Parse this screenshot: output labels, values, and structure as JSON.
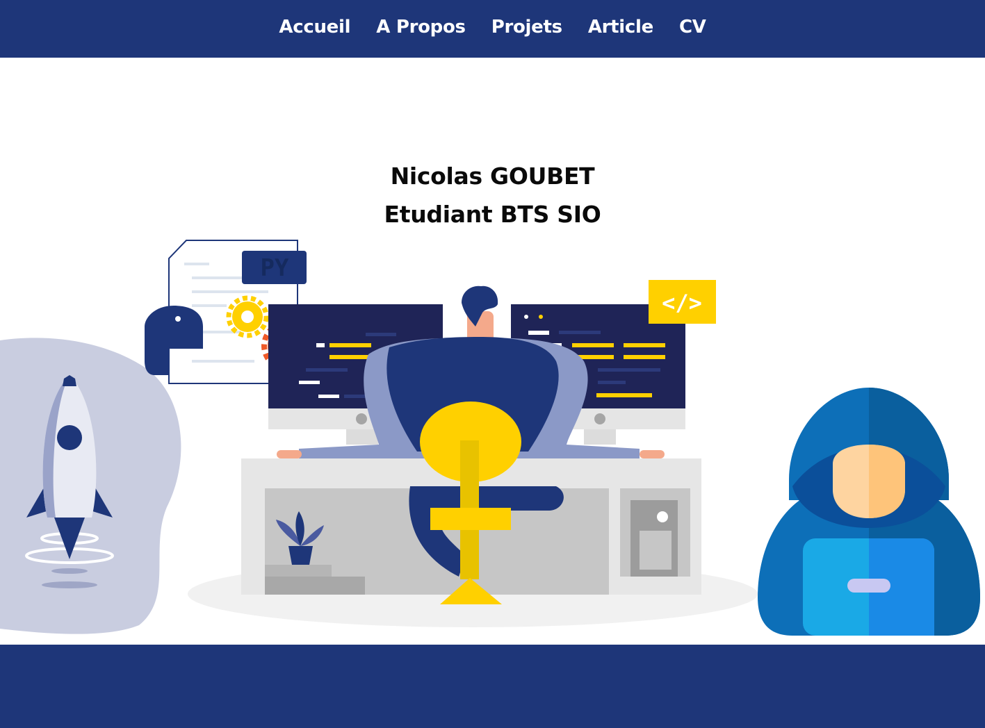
{
  "nav": {
    "items": [
      {
        "label": "Accueil"
      },
      {
        "label": "A Propos"
      },
      {
        "label": "Projets"
      },
      {
        "label": "Article"
      },
      {
        "label": "CV"
      }
    ]
  },
  "hero": {
    "name": "Nicolas GOUBET",
    "role": "Etudiant BTS SIO"
  },
  "illustration": {
    "file_badge": "PY",
    "code_badge": "</>"
  },
  "colors": {
    "primary": "#1e3679",
    "accent_yellow": "#ffd000",
    "gear_orange": "#f05a28",
    "hood_blue": "#0d6fb8"
  }
}
